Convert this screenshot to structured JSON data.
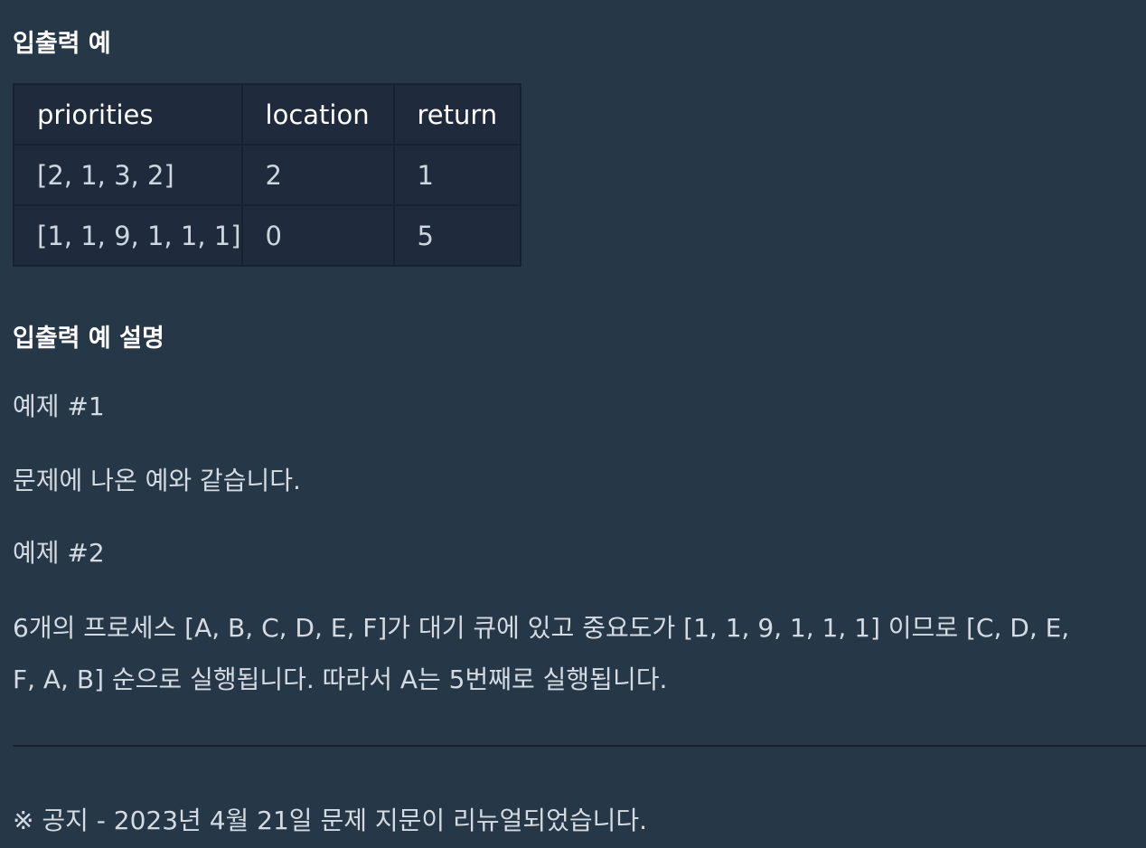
{
  "io_example": {
    "heading": "입출력 예",
    "table": {
      "headers": [
        "priorities",
        "location",
        "return"
      ],
      "rows": [
        [
          "[2, 1, 3, 2]",
          "2",
          "1"
        ],
        [
          "[1, 1, 9, 1, 1, 1]",
          "0",
          "5"
        ]
      ]
    }
  },
  "io_description": {
    "heading": "입출력 예 설명",
    "example1": {
      "title": "예제 #1",
      "text": "문제에 나온 예와 같습니다."
    },
    "example2": {
      "title": "예제 #2",
      "text_line1": "6개의 프로세스 [A, B, C, D, E, F]가 대기 큐에 있고 중요도가 [1, 1, 9, 1, 1, 1] 이므로 [C, D, E,",
      "text_line2": "F, A, B] 순으로 실행됩니다. 따라서 A는 5번째로 실행됩니다."
    }
  },
  "notice": "※ 공지 - 2023년 4월 21일 문제 지문이 리뉴얼되었습니다."
}
